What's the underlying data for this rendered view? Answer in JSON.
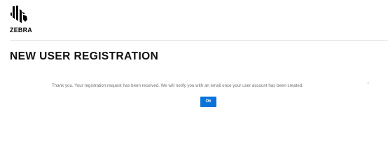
{
  "header": {
    "logo_text": "ZEBRA"
  },
  "main": {
    "title": "NEW USER REGISTRATION",
    "message": "Thank you. Your registration request has been received. We will notify you with an email once your user account has been created.",
    "ok_label": "Ok"
  },
  "colors": {
    "button": "#0a73d9",
    "message_text": "#6e6e6e",
    "title_text": "#111111"
  },
  "icons": {
    "logo": "zebra-head-logo-icon"
  }
}
